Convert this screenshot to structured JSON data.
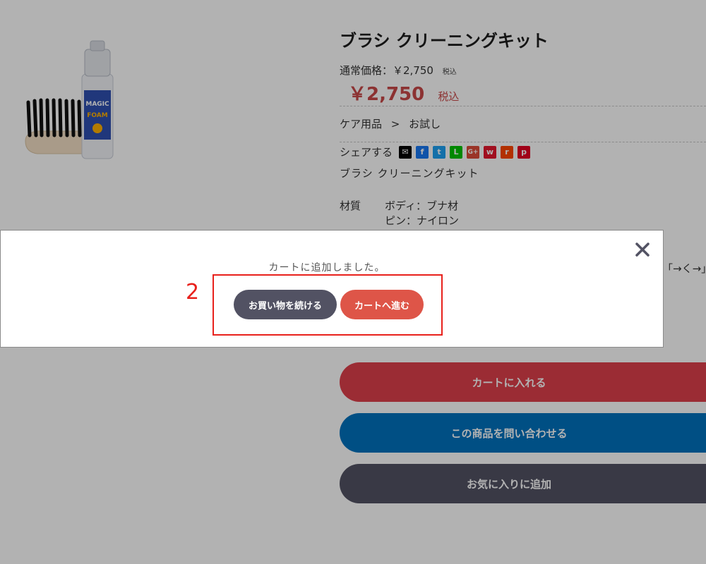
{
  "product": {
    "title": "ブラシ クリーニングキット",
    "regular_price_label": "通常価格：￥2,750",
    "regular_price_tax": "税込",
    "sale_price": "￥2,750",
    "sale_price_tax": "税込",
    "category_parent": "ケア用品",
    "category_separator": ">",
    "category_child": "お試し",
    "share_label": "シェアする",
    "description": "ブラシ クリーニングキット",
    "spec_label": "材質",
    "spec_value_1": "ボディ：ブナ材",
    "spec_value_2": "ピン：ナイロン",
    "arrow_text": "「→く→」"
  },
  "share_icons": [
    {
      "name": "mail-icon",
      "glyph": "✉",
      "color": "#000000"
    },
    {
      "name": "facebook-icon",
      "glyph": "f",
      "color": "#1877f2"
    },
    {
      "name": "twitter-icon",
      "glyph": "t",
      "color": "#1da1f2"
    },
    {
      "name": "line-icon",
      "glyph": "L",
      "color": "#00c300"
    },
    {
      "name": "google-plus-icon",
      "glyph": "G+",
      "color": "#dd4b39"
    },
    {
      "name": "weibo-icon",
      "glyph": "w",
      "color": "#e6162d"
    },
    {
      "name": "reddit-icon",
      "glyph": "r",
      "color": "#ff4500"
    },
    {
      "name": "pinterest-icon",
      "glyph": "p",
      "color": "#e60023"
    }
  ],
  "buttons": {
    "add_to_cart": "カートに入れる",
    "inquiry": "この商品を問い合わせる",
    "favorite": "お気に入りに追加"
  },
  "modal": {
    "message": "カートに追加しました。",
    "continue_shopping": "お買い物を続ける",
    "go_to_cart": "カートへ進む",
    "step_number": "2"
  },
  "colors": {
    "cart_red": "#de3f4b",
    "inquiry_blue": "#0071be",
    "dark_gray": "#525263",
    "highlight_red": "#e8211c"
  }
}
